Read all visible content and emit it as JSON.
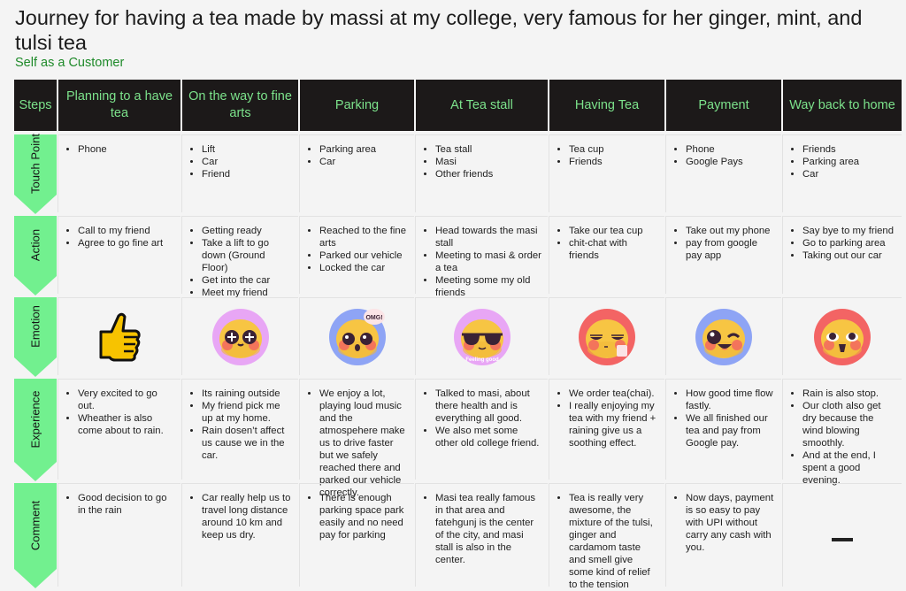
{
  "title": "Journey for having a tea made by massi at my college, very famous for her ginger, mint, and tulsi tea",
  "subtitle": "Self as a Customer",
  "colors": {
    "header_bg": "#1c1919",
    "header_text": "#7ce28b",
    "row_label_bg": "#72f08f",
    "subtitle": "#1f8a2a",
    "page_bg": "#f4f4f4"
  },
  "steps_label": "Steps",
  "stages": [
    "Planning to a have tea",
    "On the way to fine arts",
    "Parking",
    "At Tea stall",
    "Having Tea",
    "Payment",
    "Way back to home"
  ],
  "rows": {
    "touch_point": {
      "label": "Touch Point",
      "cells": [
        [
          "Phone"
        ],
        [
          "Lift",
          "Car",
          "Friend"
        ],
        [
          "Parking area",
          "Car"
        ],
        [
          "Tea stall",
          "Masi",
          "Other friends"
        ],
        [
          "Tea cup",
          "Friends"
        ],
        [
          "Phone",
          "Google Pays"
        ],
        [
          "Friends",
          "Parking area",
          "Car"
        ]
      ]
    },
    "action": {
      "label": "Action",
      "cells": [
        [
          "Call to my friend",
          "Agree to go fine art"
        ],
        [
          "Getting ready",
          "Take a lift to go down (Ground Floor)",
          "Get into the car",
          "Meet my friend"
        ],
        [
          "Reached to the fine arts",
          "Parked our vehicle",
          "Locked the car"
        ],
        [
          "Head towards the masi stall",
          "Meeting to masi & order a tea",
          "Meeting some my old friends"
        ],
        [
          "Take our tea cup",
          "chit-chat with friends"
        ],
        [
          "Take out my phone",
          "pay from google pay app"
        ],
        [
          "Say bye to my friend",
          "Go to parking area",
          "Taking out our car"
        ]
      ]
    },
    "emotion": {
      "label": "Emotion",
      "cells": [
        {
          "icon": "thumbs-up-icon"
        },
        {
          "icon": "star-eyes-emoji-icon",
          "ring": "#e8a6f5"
        },
        {
          "icon": "surprised-omg-emoji-icon",
          "ring": "#8ea4f5",
          "badge": "OMG!"
        },
        {
          "icon": "sunglasses-emoji-icon",
          "ring": "#e8a6f5",
          "caption": "Feeling good"
        },
        {
          "icon": "relaxed-tea-emoji-icon",
          "ring": "#f36464"
        },
        {
          "icon": "wink-emoji-icon",
          "ring": "#8ea4f5"
        },
        {
          "icon": "excited-emoji-icon",
          "ring": "#f36464"
        }
      ]
    },
    "experience": {
      "label": "Experience",
      "cells": [
        [
          "Very excited to go out.",
          "Wheather is also come about to rain."
        ],
        [
          "Its raining outside",
          "My friend pick me up at my home.",
          "Rain dosen’t affect us cause we in the car."
        ],
        [
          "We enjoy a lot, playing loud music and the atmospehere make us to drive faster but we safely reached there and parked our vehicle correctly."
        ],
        [
          "Talked to masi, about there health and is everything all good.",
          "We also met some other old college friend."
        ],
        [
          "We order tea(chai).",
          "I really enjoying my tea with my friend + raining give us a soothing effect."
        ],
        [
          "How good time flow fastly.",
          "We all finished our tea and pay from Google pay."
        ],
        [
          "Rain is also stop.",
          "Our cloth also get dry because the wind blowing smoothly.",
          "And at the end, I spent a good evening."
        ]
      ]
    },
    "comment": {
      "label": "Comment",
      "cells": [
        [
          "Good decision to go in the rain"
        ],
        [
          "Car really help us to travel long distance around 10 km and keep us dry."
        ],
        [
          "There is enough parking space park easily and no need pay for parking"
        ],
        [
          "Masi tea really famous in that area and fatehgunj is the center of the city, and masi stall is also in the center."
        ],
        [
          "Tea is really very awesome, the mixture of the tulsi, ginger and cardamom taste and smell give some kind of relief to the tension"
        ],
        [
          "Now days, payment is so easy to pay with UPI without carry any cash with you."
        ],
        []
      ]
    }
  }
}
